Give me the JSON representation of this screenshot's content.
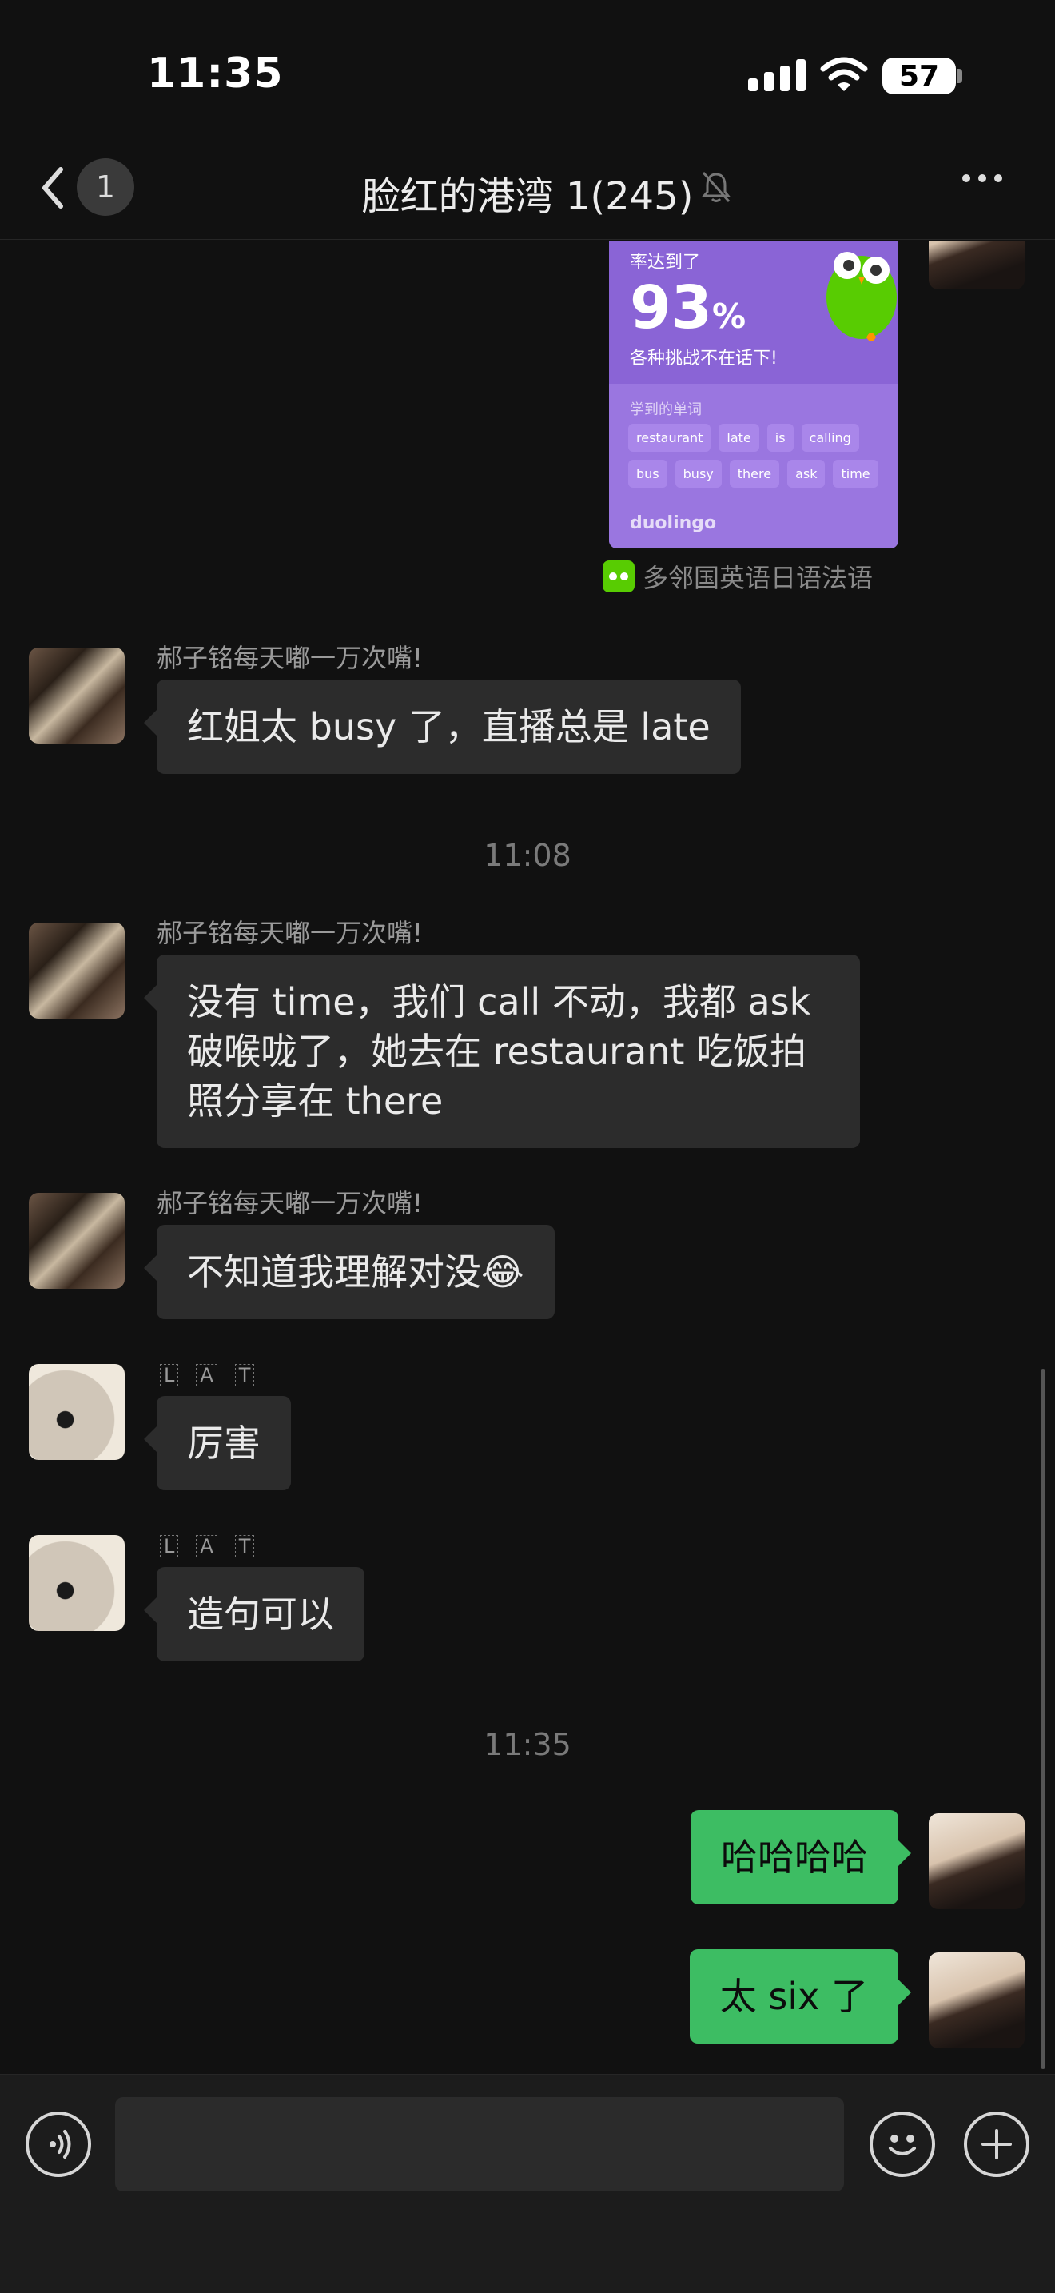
{
  "status_bar": {
    "time": "11:35",
    "battery": "57"
  },
  "header": {
    "unread_count": "1",
    "title": "脸红的港湾 1(245)"
  },
  "duolingo_card": {
    "top_text": "率达到了",
    "percent_value": "93",
    "percent_sign": "%",
    "subtitle": "各种挑战不在话下!",
    "learned_label": "学到的单词",
    "words": [
      "restaurant",
      "late",
      "is",
      "calling",
      "bus",
      "busy",
      "there",
      "ask",
      "time"
    ],
    "brand": "duolingo",
    "source_label": "多邻国英语日语法语"
  },
  "messages": [
    {
      "sender": "郝子铭每天嘟一万次嘴!",
      "text": "红姐太 busy 了，直播总是 late"
    },
    {
      "sender": "郝子铭每天嘟一万次嘴!",
      "text_lines": [
        "没有 time，我们 call 不动，我都 ask",
        "破喉咙了，她去在 restaurant 吃饭拍",
        "照分享在 there"
      ]
    },
    {
      "sender": "郝子铭每天嘟一万次嘴!",
      "text": "不知道我理解对没😂"
    },
    {
      "sender_glyphs": [
        "L",
        "A",
        "T"
      ],
      "text": "厉害"
    },
    {
      "sender_glyphs": [
        "L",
        "A",
        "T"
      ],
      "text": "造句可以"
    },
    {
      "text": "哈哈哈哈",
      "mine": true
    },
    {
      "text": "太 six 了",
      "mine": true
    }
  ],
  "timestamps": [
    "11:08",
    "11:35"
  ],
  "colors": {
    "background": "#111111",
    "bubble_other": "#2c2c2c",
    "bubble_mine": "#3dbd63",
    "duolingo": "#8a64d6"
  },
  "icons": [
    "back-icon",
    "mute-bell-icon",
    "more-icon",
    "voice-icon",
    "emoji-icon",
    "plus-icon"
  ]
}
